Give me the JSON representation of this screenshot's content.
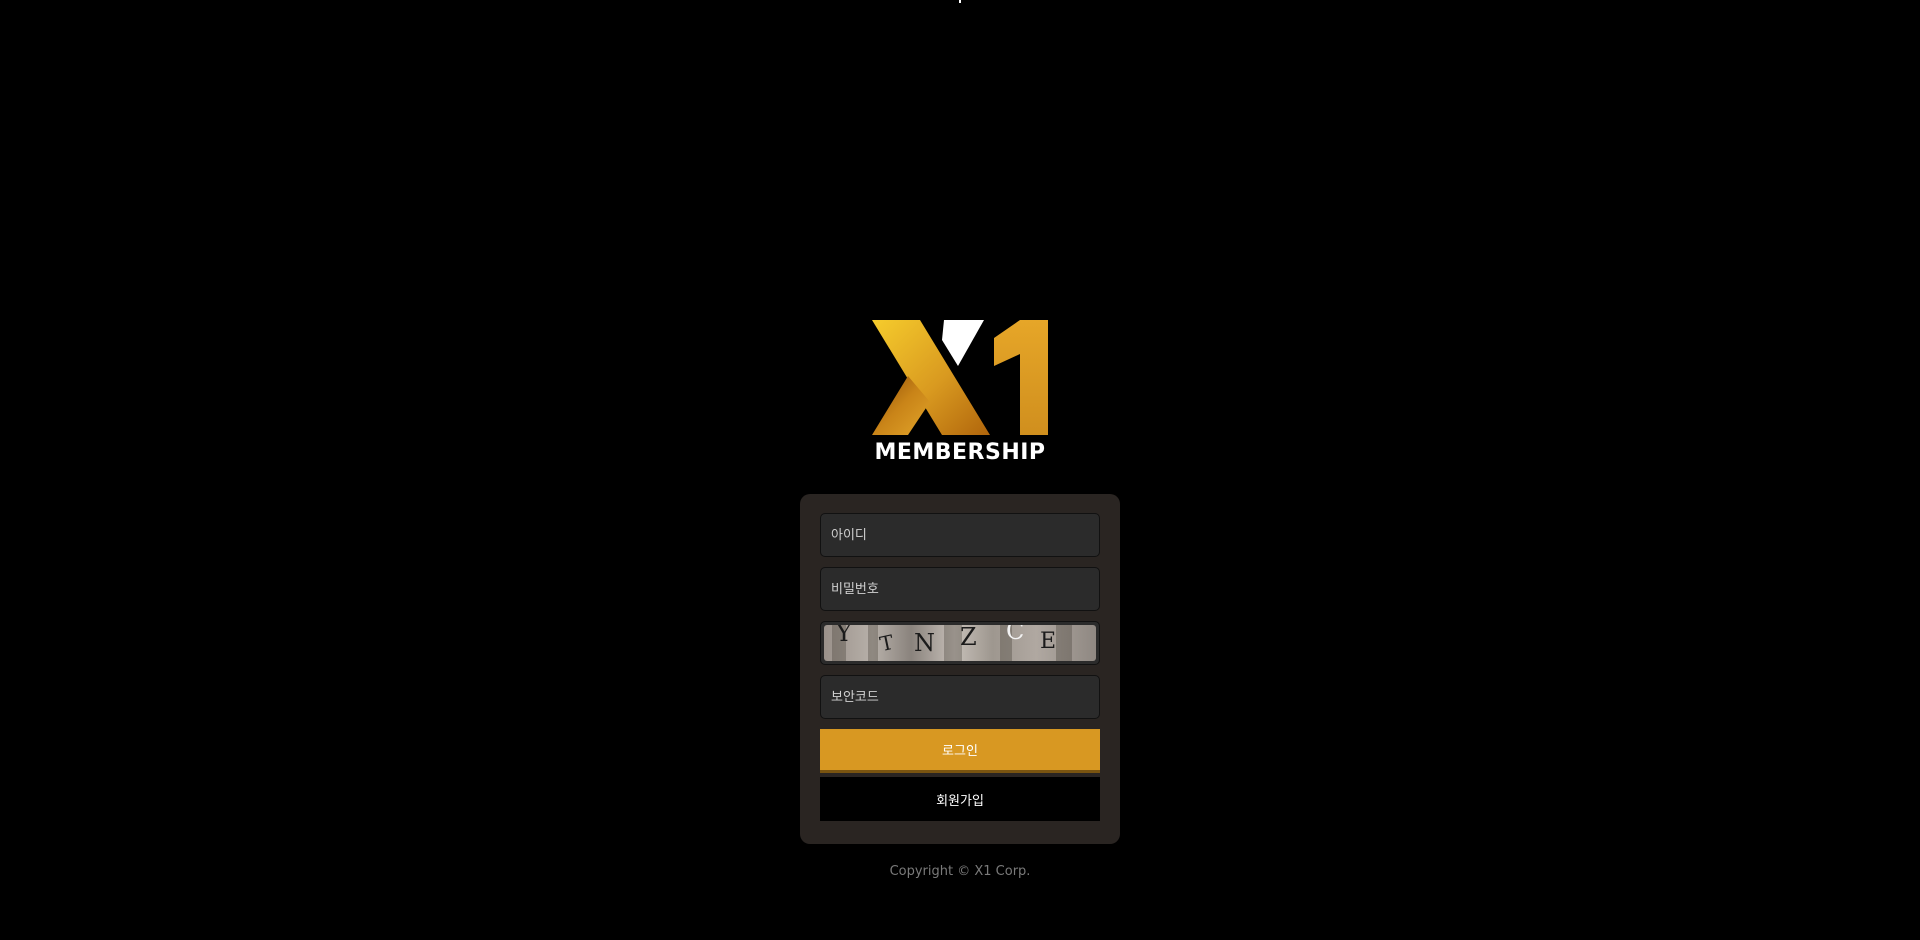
{
  "logo": {
    "mark": "X1",
    "wordmark": "MEMBERSHIP"
  },
  "login_form": {
    "id_placeholder": "아이디",
    "password_placeholder": "비밀번호",
    "captcha_text": "YTNZCE",
    "security_code_placeholder": "보안코드",
    "login_button": "로그인",
    "signup_button": "회원가입"
  },
  "footer": {
    "copyright": "Copyright © X1 Corp."
  },
  "colors": {
    "background": "#000000",
    "panel": "#2a2522",
    "field": "#2b2b2b",
    "accent": "#d89822",
    "logo_gold_light": "#f3c42a",
    "logo_gold_dark": "#b8720e"
  }
}
